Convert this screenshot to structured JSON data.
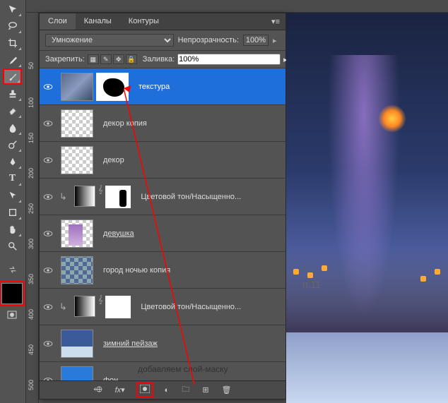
{
  "tabs": {
    "layers": "Слои",
    "channels": "Каналы",
    "paths": "Контуры"
  },
  "blend": {
    "mode": "Умножение",
    "opacity_label": "Непрозрачность:",
    "opacity": "100%",
    "lock_label": "Закрепить:",
    "fill_label": "Заливка:",
    "fill": "100%"
  },
  "layers": [
    {
      "name": "текстура",
      "selected": true,
      "has_mask": true,
      "mask_hl": true
    },
    {
      "name": "декор копия"
    },
    {
      "name": "декор"
    },
    {
      "name": "Цветовой тон/Насыщенно...",
      "adj": true,
      "clip": true
    },
    {
      "name": "девушка",
      "link": true
    },
    {
      "name": "город ночью копия"
    },
    {
      "name": "Цветовой тон/Насыщенно...",
      "adj": true,
      "clip": true
    },
    {
      "name": "зимний пейзаж",
      "link": true
    },
    {
      "name": "фон"
    }
  ],
  "ruler": [
    "50",
    "100",
    "150",
    "200",
    "250",
    "300",
    "350",
    "400",
    "450",
    "500"
  ],
  "annotation": "добавляем слой-маску",
  "step": "п.11"
}
